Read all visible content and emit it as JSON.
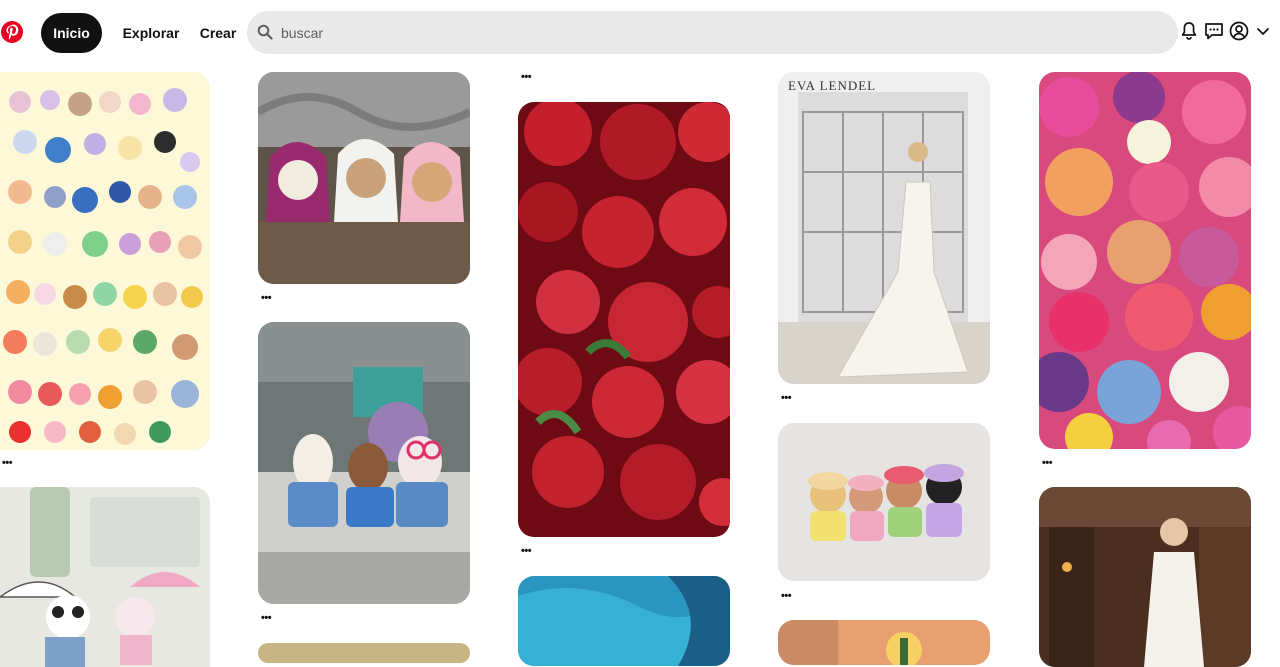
{
  "nav": {
    "home": "Inicio",
    "explore": "Explorar",
    "create": "Crear"
  },
  "search": {
    "placeholder": "buscar"
  },
  "header_icons": [
    "bell-icon",
    "messages-icon",
    "account-icon",
    "chevron-down-icon"
  ],
  "pin_menu_glyph": "•••",
  "pins": [
    {
      "id": "sylvanian-sticker-sheet",
      "colors": [
        "#fdf8d8",
        "#f3c9c9"
      ]
    },
    {
      "id": "hooded-rabbits",
      "colors": [
        "#6a5a4a",
        "#c0669a"
      ]
    },
    {
      "id": "red-roses",
      "colors": [
        "#8e0f1b",
        "#d12b35"
      ]
    },
    {
      "id": "eva-lendel-bridal",
      "brand": "EVA LENDEL",
      "colors": [
        "#eeeeee",
        "#d8d4cc"
      ]
    },
    {
      "id": "hibiscus-collage",
      "colors": [
        "#e0528a",
        "#f59a3d"
      ]
    },
    {
      "id": "classroom-critters",
      "colors": [
        "#7a8a8a",
        "#8cb0d8"
      ]
    },
    {
      "id": "crochet-hat-babies",
      "colors": [
        "#e8e6e4",
        "#d9a6b7"
      ]
    },
    {
      "id": "panda-umbrellas",
      "colors": [
        "#e8e8e2",
        "#f0b7cc"
      ]
    },
    {
      "id": "blue-abstract",
      "colors": [
        "#2fa2c8",
        "#1c6f99"
      ]
    },
    {
      "id": "bride-fireplace",
      "colors": [
        "#5a3b2a",
        "#f2f0ea"
      ]
    }
  ]
}
